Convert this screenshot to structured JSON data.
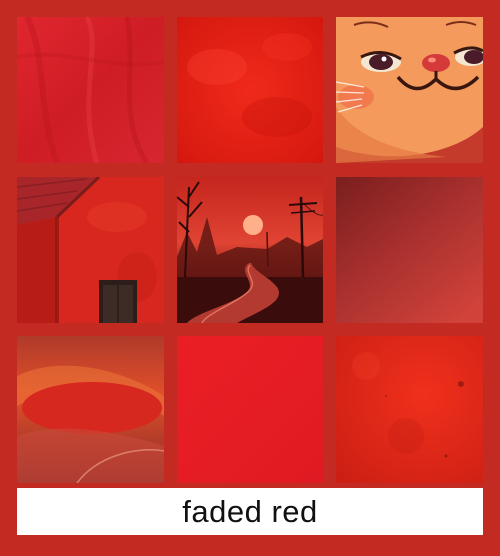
{
  "caption": {
    "text": "faded red"
  },
  "colors": {
    "frame": "#c22a22",
    "caption_bg": "#ffffff",
    "caption_text": "#111111"
  },
  "tiles": [
    {
      "name": "fabric-texture-tile"
    },
    {
      "name": "smoky-red-texture-tile"
    },
    {
      "name": "cartoon-cat-face-tile"
    },
    {
      "name": "red-barn-wall-tile"
    },
    {
      "name": "foggy-road-sunset-tile"
    },
    {
      "name": "dark-red-gradient-tile"
    },
    {
      "name": "abstract-red-curves-tile"
    },
    {
      "name": "plain-red-tile"
    },
    {
      "name": "grunge-red-texture-tile"
    }
  ]
}
